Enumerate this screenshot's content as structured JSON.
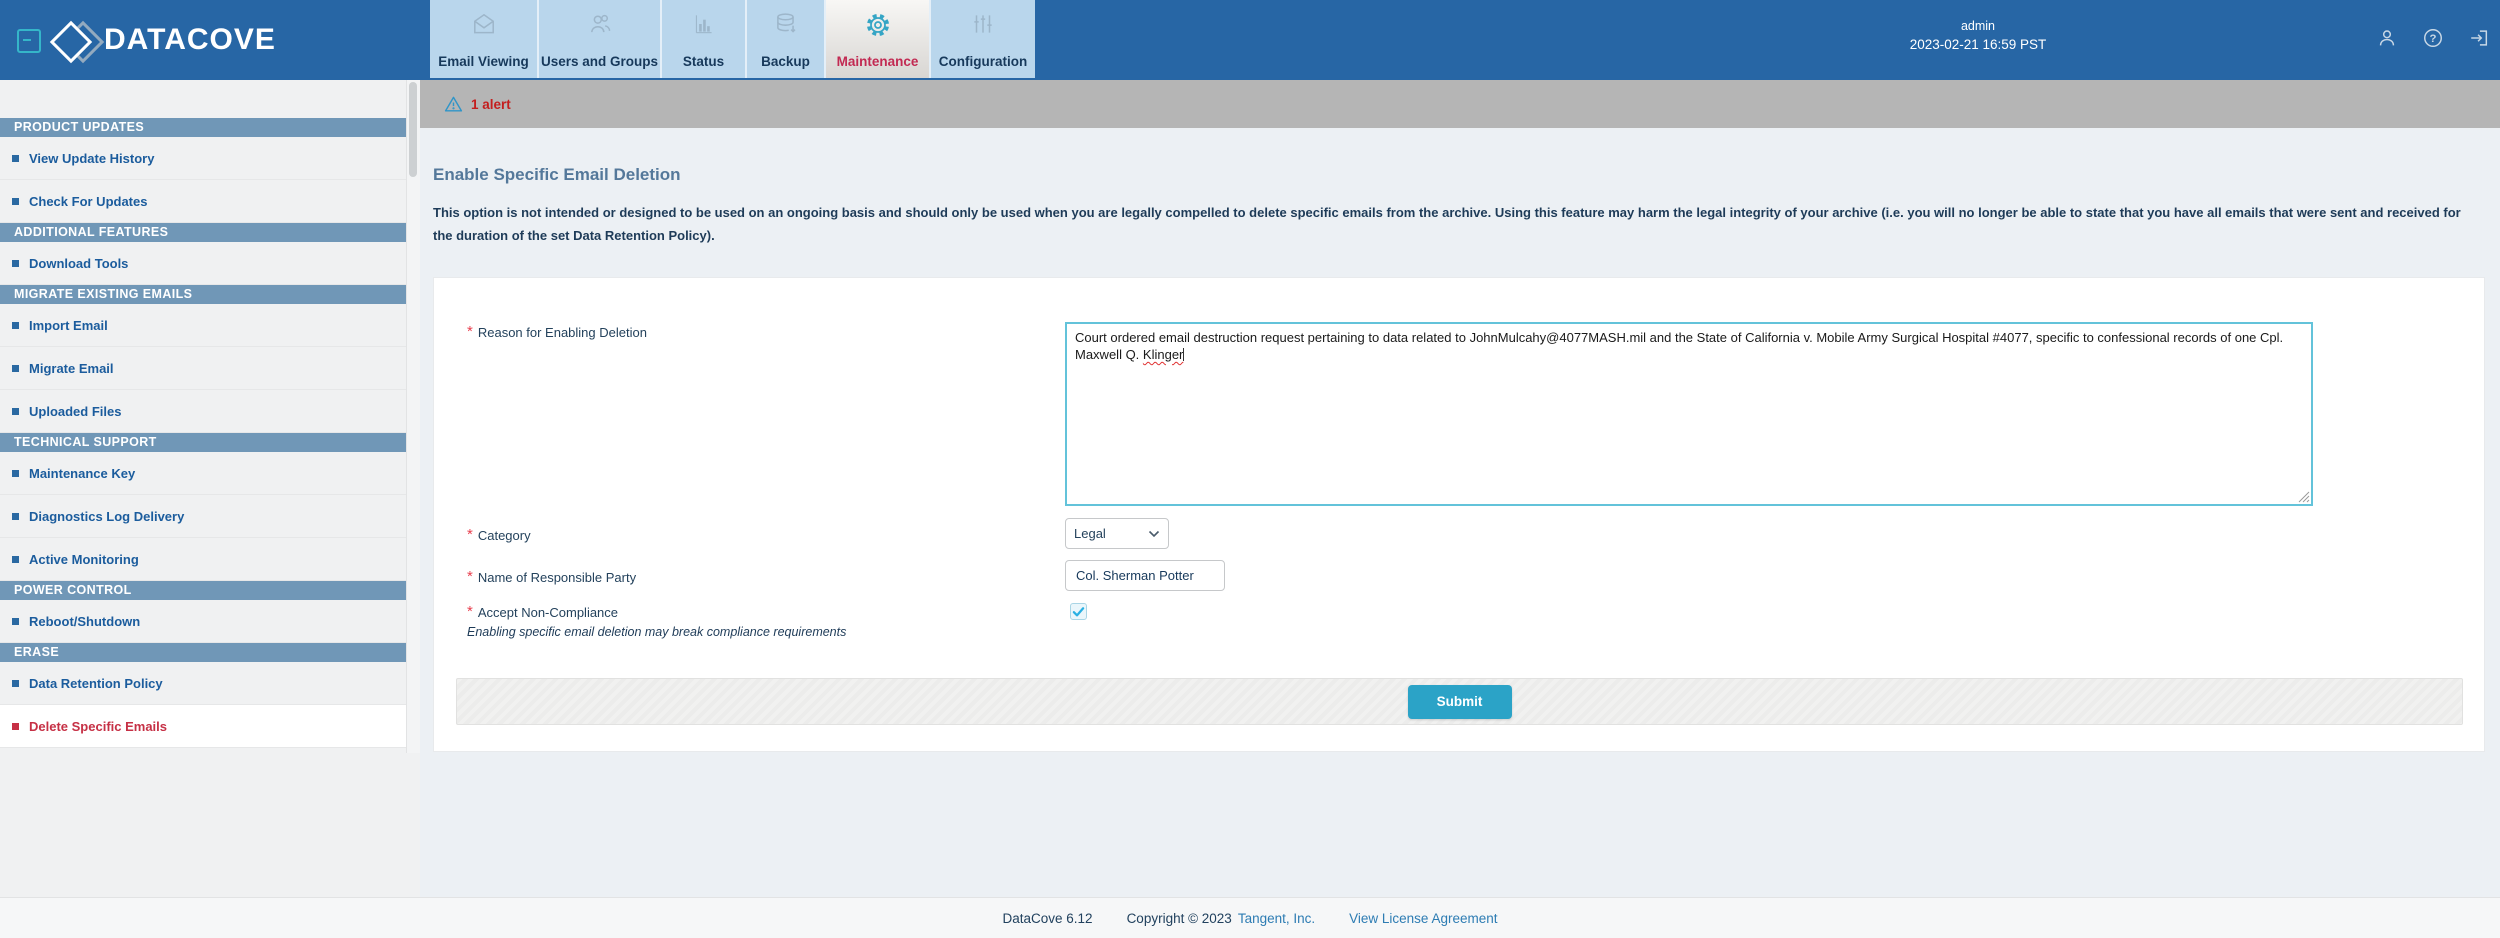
{
  "header": {
    "brand": "DATACOVE",
    "tabs": [
      {
        "label": "Email Viewing",
        "icon": "envelope-icon",
        "active": false
      },
      {
        "label": "Users and Groups",
        "icon": "users-icon",
        "active": false
      },
      {
        "label": "Status",
        "icon": "bar-chart-icon",
        "active": false
      },
      {
        "label": "Backup",
        "icon": "database-icon",
        "active": false
      },
      {
        "label": "Maintenance",
        "icon": "gear-icon",
        "active": true
      },
      {
        "label": "Configuration",
        "icon": "sliders-icon",
        "active": false
      }
    ],
    "user": "admin",
    "datetime": "2023-02-21 16:59 PST"
  },
  "alert_bar": {
    "label": "1 alert"
  },
  "sidebar": {
    "sections": [
      {
        "title": "PRODUCT UPDATES",
        "items": [
          {
            "label": "View Update History"
          },
          {
            "label": "Check For Updates"
          }
        ]
      },
      {
        "title": "ADDITIONAL FEATURES",
        "items": [
          {
            "label": "Download Tools"
          }
        ]
      },
      {
        "title": "MIGRATE EXISTING EMAILS",
        "items": [
          {
            "label": "Import Email"
          },
          {
            "label": "Migrate Email"
          },
          {
            "label": "Uploaded Files"
          }
        ]
      },
      {
        "title": "TECHNICAL SUPPORT",
        "items": [
          {
            "label": "Maintenance Key"
          },
          {
            "label": "Diagnostics Log Delivery"
          },
          {
            "label": "Active Monitoring"
          }
        ]
      },
      {
        "title": "POWER CONTROL",
        "items": [
          {
            "label": "Reboot/Shutdown"
          }
        ]
      },
      {
        "title": "ERASE",
        "items": [
          {
            "label": "Data Retention Policy"
          },
          {
            "label": "Delete Specific Emails",
            "active": true
          }
        ]
      }
    ]
  },
  "main": {
    "title": "Enable Specific Email Deletion",
    "description": "This option is not intended or designed to be used on an ongoing basis and should only be used when you are legally compelled to delete specific emails from the archive. Using this feature may harm the legal integrity of your archive (i.e. you will no longer be able to state that you have all emails that were sent and received for the duration of the set Data Retention Policy).",
    "form": {
      "reason_label": "Reason for Enabling Deletion",
      "reason_value_before": "Court ordered email destruction request pertaining to data related to JohnMulcahy@4077MASH.mil and the State of California v. Mobile Army Surgical Hospital #4077, specific to confessional records of one Cpl. Maxwell Q. ",
      "reason_value_misspelled": "Klinger",
      "category_label": "Category",
      "category_value": "Legal",
      "name_label": "Name of Responsible Party",
      "name_value": "Col. Sherman Potter",
      "accept_label": "Accept Non-Compliance",
      "accept_note": "Enabling specific email deletion may break compliance requirements",
      "accept_checked": true,
      "submit_label": "Submit"
    }
  },
  "footer": {
    "version": "DataCove 6.12",
    "copyright": "Copyright © 2023",
    "company": "Tangent, Inc.",
    "license": "View License Agreement"
  },
  "colors": {
    "header_blue": "#2766a5",
    "tab_blue": "#b9d6ec",
    "active_tab_text": "#c22a52",
    "accent_teal": "#35b6c9",
    "alert_gray": "#b5b5b5",
    "alert_red": "#c41e1e",
    "sidebar_section_blue": "#7097b7",
    "sidebar_link_blue": "#1b5c9d",
    "active_item_red": "#c63045",
    "textarea_border_cyan": "#63c3da",
    "submit_cyan": "#2ba3c7",
    "footer_link_blue": "#2d7cb3"
  }
}
